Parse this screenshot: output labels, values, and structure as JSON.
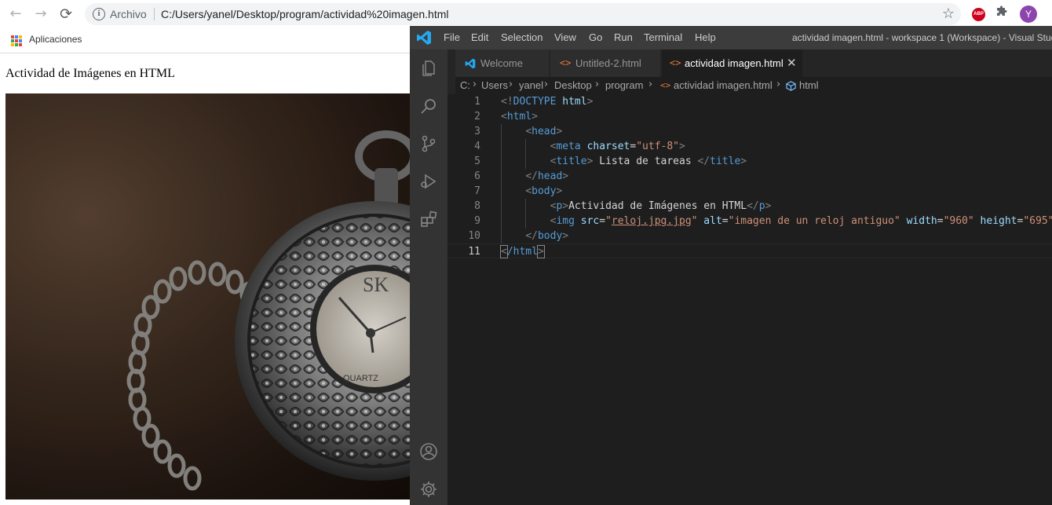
{
  "browser": {
    "back_label": "←",
    "forward_label": "→",
    "reload_label": "⟳",
    "omnibox": {
      "security_label": "Archivo",
      "url": "C:/Users/yanel/Desktop/program/actividad%20imagen.html",
      "star": "☆"
    },
    "extensions": {
      "abp": "ABP",
      "puzzle": "✱",
      "avatar": "Y"
    },
    "bookmarks": {
      "apps_label": "Aplicaciones"
    }
  },
  "page": {
    "paragraph": "Actividad de Imágenes en HTML",
    "image_alt": "imagen de un reloj antiguo",
    "watch": {
      "brand": "SK",
      "dial_text": "QUARTZ"
    }
  },
  "vscode": {
    "menu": [
      "File",
      "Edit",
      "Selection",
      "View",
      "Go",
      "Run",
      "Terminal",
      "Help"
    ],
    "window_title": "actividad imagen.html - workspace 1 (Workspace) - Visual Stud",
    "tabs": [
      {
        "label": "Welcome",
        "active": false
      },
      {
        "label": "Untitled-2.html",
        "active": false
      },
      {
        "label": "actividad imagen.html",
        "active": true
      }
    ],
    "tab_close": "✕",
    "breadcrumb": [
      "C:",
      "Users",
      "yanel",
      "Desktop",
      "program",
      "actividad imagen.html",
      "html"
    ],
    "breadcrumb_sep": "›",
    "line_numbers": [
      "1",
      "2",
      "3",
      "4",
      "5",
      "6",
      "7",
      "8",
      "9",
      "10",
      "11"
    ],
    "current_line": 11,
    "code": {
      "l1": {
        "a": "<!",
        "b": "DOCTYPE",
        "c": " html",
        "d": ">"
      },
      "l2": {
        "a": "<",
        "b": "html",
        "c": ">"
      },
      "l3": {
        "a": "<",
        "b": "head",
        "c": ">"
      },
      "l4": {
        "a": "<",
        "b": "meta",
        "c": " charset",
        "d": "=",
        "e": "\"utf-8\"",
        "f": ">"
      },
      "l5": {
        "a": "<",
        "b": "title",
        "c": ">",
        "d": " Lista de tareas ",
        "e": "</",
        "f": "title",
        "g": ">"
      },
      "l6": {
        "a": "</",
        "b": "head",
        "c": ">"
      },
      "l7": {
        "a": "<",
        "b": "body",
        "c": ">"
      },
      "l8": {
        "a": "<",
        "b": "p",
        "c": ">",
        "d": "Actividad de Imágenes en HTML",
        "e": "</",
        "f": "p",
        "g": ">"
      },
      "l9": {
        "a": "<",
        "b": "img",
        "c": " src",
        "d": "=",
        "e": "\"",
        "f": "reloj.jpg.jpg",
        "g": "\"",
        "h": " alt",
        "i": "=",
        "j": "\"imagen de un reloj antiguo\"",
        "k": " width",
        "l": "=",
        "m": "\"960\"",
        "n": " height",
        "o": "=",
        "p": "\"695\"",
        "q": ">"
      },
      "l10": {
        "a": "</",
        "b": "body",
        "c": ">"
      },
      "l11": {
        "a": "<",
        "b": "/html",
        "c": ">"
      }
    }
  },
  "colors": {
    "vscode_bg": "#1e1e1e",
    "activity_bar": "#333333",
    "titlebar": "#3c3c3c",
    "html_icon": "#e37933",
    "html_tag": "#569cd6",
    "attr": "#9cdcfe",
    "string": "#ce9178",
    "avatar": "#8e44ad",
    "abp": "#d0021b"
  }
}
